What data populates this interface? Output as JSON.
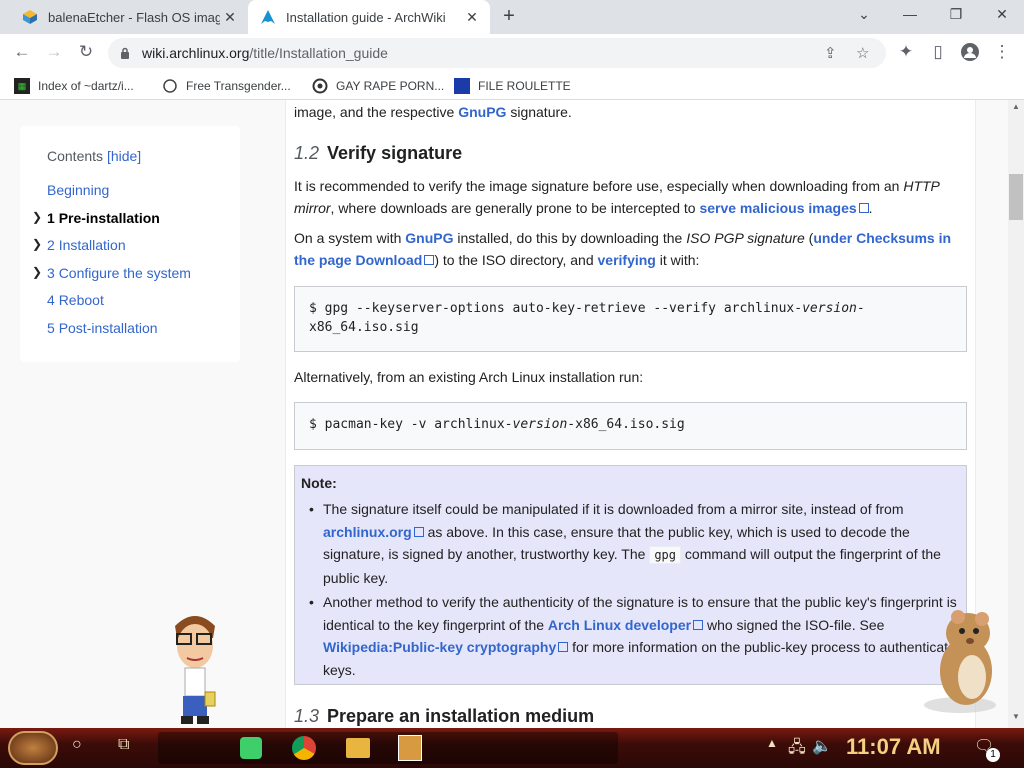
{
  "tabs": [
    {
      "title": "balenaEtcher - Flash OS images",
      "favicon": "etcher-cube-icon"
    },
    {
      "title": "Installation guide - ArchWiki",
      "favicon": "arch-logo-icon"
    }
  ],
  "toolbar": {
    "url_host": "wiki.archlinux.org",
    "url_path": "/title/Installation_guide"
  },
  "bookmarks": [
    {
      "label": "Index of ~dartz/i..."
    },
    {
      "label": "Free Transgender..."
    },
    {
      "label": "GAY RAPE PORN..."
    },
    {
      "label": "FILE ROULETTE"
    }
  ],
  "toc": {
    "title": "Contents",
    "hide": "[hide]",
    "items": [
      {
        "label": "Beginning"
      },
      {
        "num": "1",
        "label": "Pre-installation"
      },
      {
        "num": "2",
        "label": "Installation"
      },
      {
        "num": "3",
        "label": "Configure the system"
      },
      {
        "num": "4",
        "label": "Reboot"
      },
      {
        "num": "5",
        "label": "Post-installation"
      }
    ]
  },
  "article": {
    "top_text_a": "image, and the respective ",
    "top_link": "GnuPG",
    "top_text_b": " signature.",
    "s12_num": "1.2",
    "s12_title": "Verify signature",
    "p1_a": "It is recommended to verify the image signature before use, especially when downloading from an ",
    "p1_em": "HTTP mirror",
    "p1_b": ", where downloads are generally prone to be intercepted to ",
    "p1_link": "serve malicious images",
    "p1_c": ".",
    "p2_a": "On a system with ",
    "p2_link1": "GnuPG",
    "p2_b": " installed, do this by downloading the ",
    "p2_em": "ISO PGP signature",
    "p2_c": " (",
    "p2_link2": "under Checksums in the page Download",
    "p2_d": ") to the ISO directory, and ",
    "p2_link3": "verifying",
    "p2_e": " it with:",
    "code1_a": "$ gpg --keyserver-options auto-key-retrieve --verify archlinux-",
    "code1_em": "version",
    "code1_b": "-x86_64.iso.sig",
    "p3": "Alternatively, from an existing Arch Linux installation run:",
    "code2_a": "$ pacman-key -v archlinux-",
    "code2_em": "version",
    "code2_b": "-x86_64.iso.sig",
    "note_title": "Note:",
    "n1_a": "The signature itself could be manipulated if it is downloaded from a mirror site, instead of from ",
    "n1_link": "archlinux.org",
    "n1_b": " as above. In this case, ensure that the public key, which is used to decode the signature, is signed by another, trustworthy key. The ",
    "n1_code": "gpg",
    "n1_c": " command will output the fingerprint of the public key.",
    "n2_a": "Another method to verify the authenticity of the signature is to ensure that the public key's fingerprint is identical to the key fingerprint of the ",
    "n2_link1": "Arch Linux developer",
    "n2_b": " who signed the ISO-file. See ",
    "n2_link2": "Wikipedia:Public-key cryptography",
    "n2_c": " for more information on the public-key process to authenticate keys.",
    "s13_num": "1.3",
    "s13_title": "Prepare an installation medium"
  },
  "taskbar": {
    "clock": "11:07 AM",
    "notification_count": "1"
  },
  "colors": {
    "link": "#3366cc",
    "note_bg": "#e6e6fa",
    "taskbar": "#5a1209",
    "clock": "#f5d080"
  }
}
